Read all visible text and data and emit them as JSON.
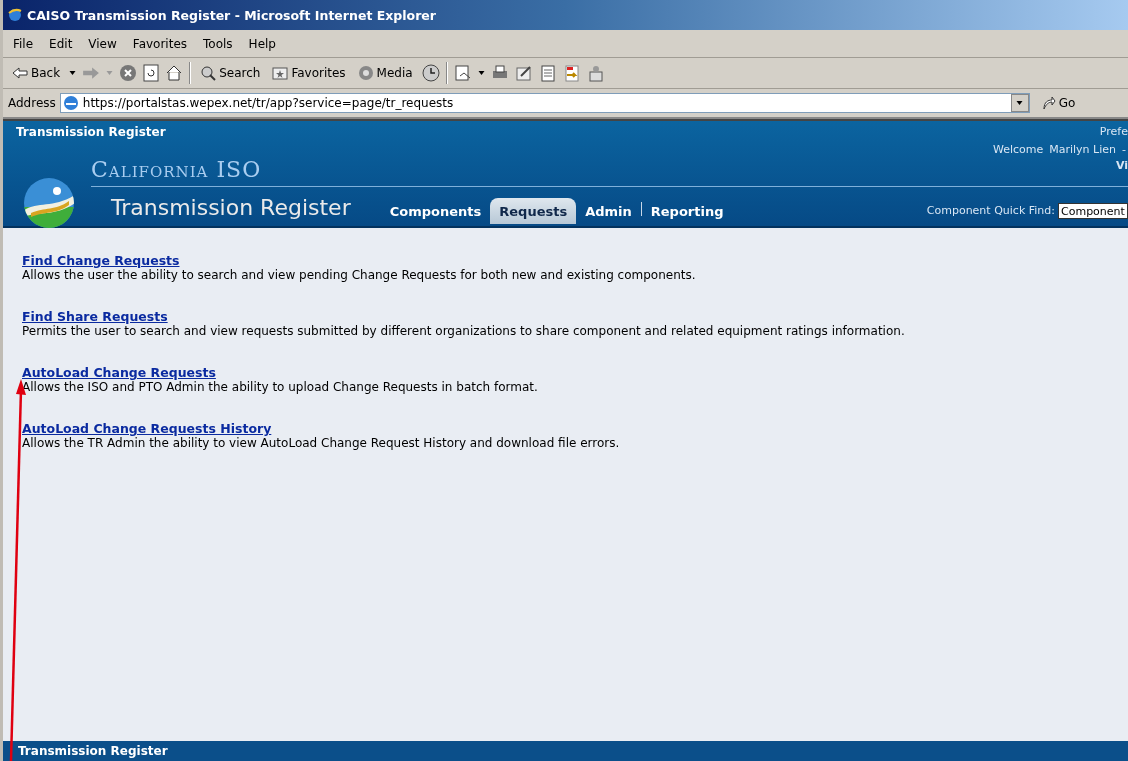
{
  "window": {
    "title": "CAISO Transmission Register - Microsoft Internet Explorer"
  },
  "menu": [
    "File",
    "Edit",
    "View",
    "Favorites",
    "Tools",
    "Help"
  ],
  "toolbar": {
    "back": "Back",
    "search": "Search",
    "favorites": "Favorites",
    "media": "Media"
  },
  "address": {
    "label": "Address",
    "value": "https://portalstas.wepex.net/tr/app?service=page/tr_requests",
    "go": "Go"
  },
  "header": {
    "app_name": "Transmission Register",
    "top_right": "Prefe",
    "welcome": "Welcome",
    "user": "Marilyn Lien",
    "dash": "-",
    "third_line": "Vi",
    "org": "California ISO",
    "title": "Transmission Register",
    "quick_find_label": "Component Quick Find:",
    "quick_find_value": "Component"
  },
  "tabs": [
    {
      "label": "Components",
      "selected": false
    },
    {
      "label": "Requests",
      "selected": true
    },
    {
      "label": "Admin",
      "selected": false
    },
    {
      "label": "Reporting",
      "selected": false
    }
  ],
  "links": [
    {
      "title": "Find Change Requests",
      "description": "Allows the user the ability to search and view pending Change Requests for both new and existing components."
    },
    {
      "title": "Find Share Requests",
      "description": "Permits the user to search and view requests submitted by different organizations to share component and related equipment ratings information."
    },
    {
      "title": "AutoLoad Change Requests",
      "description": "Allows the ISO and PTO Admin the ability to upload Change Requests in batch format."
    },
    {
      "title": "AutoLoad Change Requests History",
      "description": "Allows the TR Admin the ability to view AutoLoad Change Request History and download file errors."
    }
  ],
  "footer": {
    "text": "Transmission Register"
  }
}
